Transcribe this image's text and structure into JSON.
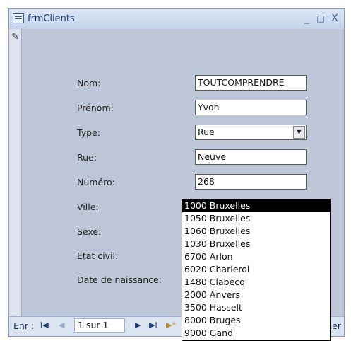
{
  "window": {
    "title": "frmClients",
    "minimize": "_",
    "maximize": "□",
    "close": "X"
  },
  "selector": {
    "edit_glyph": "✎"
  },
  "form": {
    "fields": [
      {
        "label": "Nom:",
        "value": "TOUTCOMPRENDRE"
      },
      {
        "label": "Prénom:",
        "value": "Yvon"
      },
      {
        "label": "Type:",
        "value": "Rue"
      },
      {
        "label": "Rue:",
        "value": "Neuve"
      },
      {
        "label": "Numéro:",
        "value": "268"
      },
      {
        "label": "Ville:",
        "value": ""
      },
      {
        "label": "Sexe:"
      },
      {
        "label": "Etat civil:"
      },
      {
        "label": "Date de naissance:"
      }
    ],
    "combo_arrow": "▼"
  },
  "ville_dropdown": {
    "options": [
      "1000 Bruxelles",
      "1050 Bruxelles",
      "1060 Bruxelles",
      "1030 Bruxelles",
      "6700 Arlon",
      "6020 Charleroi",
      "1480 Clabecq",
      "2000 Anvers",
      "3500 Hasselt",
      "8000 Bruges",
      "9000 Gand"
    ],
    "selected": "1000 Bruxelles"
  },
  "navbar": {
    "label": "Enr :",
    "first": "I◀",
    "prev": "◀",
    "counter": "1 sur 1",
    "next": "▶",
    "last": "▶I",
    "new": "▶*",
    "search_partial": "her"
  }
}
